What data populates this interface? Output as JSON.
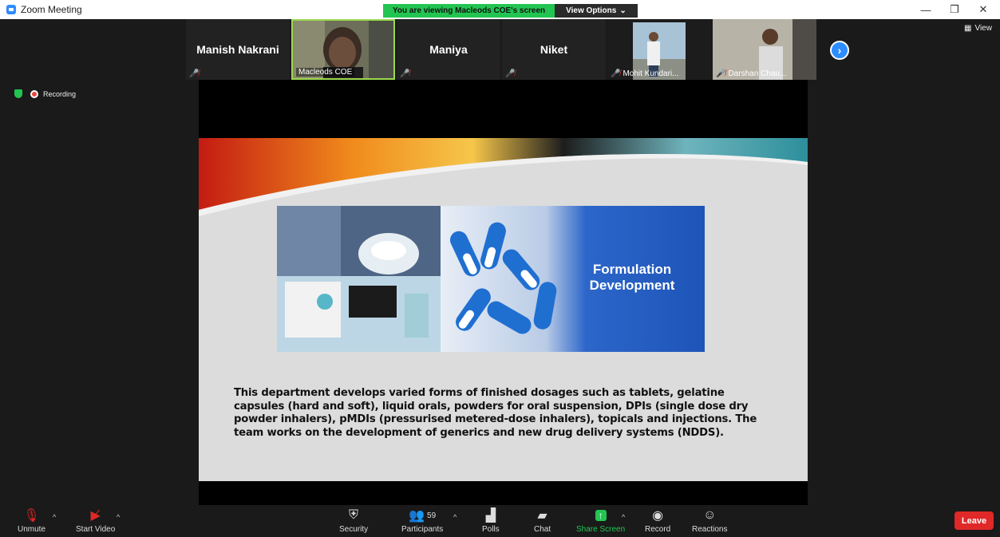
{
  "window": {
    "title": "Zoom Meeting",
    "controls": [
      "—",
      "❐",
      "✕"
    ]
  },
  "share_banner": {
    "viewing_text": "You are viewing Macleods COE's screen",
    "view_options_label": "View Options",
    "view_options_caret": "⌄"
  },
  "view_button": {
    "label": "View"
  },
  "status": {
    "recording_label": "Recording"
  },
  "participants_strip": [
    {
      "name": "Manish Nakrani",
      "has_video": false,
      "muted": true
    },
    {
      "name": "Macleods COE",
      "has_video": true,
      "muted": false,
      "active_speaker": true
    },
    {
      "name": "Maniya",
      "has_video": false,
      "muted": true
    },
    {
      "name": "Niket",
      "has_video": false,
      "muted": true
    },
    {
      "name": "Mohit Kundari...",
      "has_video": true,
      "muted": true
    },
    {
      "name": "Darshan Chau...",
      "has_video": true,
      "muted": true
    }
  ],
  "slide": {
    "hero_title_line1": "Formulation",
    "hero_title_line2": "Development",
    "body_text": "This department develops varied forms of finished dosages such as tablets, gelatine capsules (hard and soft), liquid orals, powders for oral suspension, DPIs (single dose dry powder inhalers), pMDIs (pressurised metered-dose inhalers), topicals and injections. The team works on the development of generics and new drug delivery systems (NDDS)."
  },
  "toolbar": {
    "unmute": "Unmute",
    "start_video": "Start Video",
    "security": "Security",
    "participants": "Participants",
    "participants_count": "59",
    "polls": "Polls",
    "chat": "Chat",
    "share_screen": "Share Screen",
    "record": "Record",
    "reactions": "Reactions",
    "leave": "Leave",
    "caret": "^"
  },
  "colors": {
    "zoom_blue": "#2d8cff",
    "share_green": "#23c552",
    "leave_red": "#e02828",
    "active_speaker_border": "#9cd84e"
  }
}
